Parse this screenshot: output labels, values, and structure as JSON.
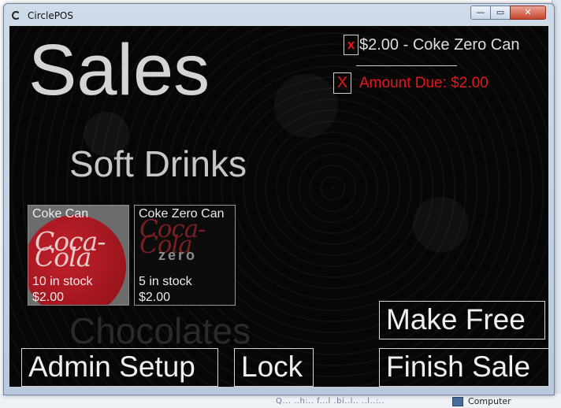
{
  "window": {
    "title": "CirclePOS",
    "controls": {
      "minimize": "—",
      "maximize": "▭",
      "close": "✕"
    }
  },
  "desktop": {
    "bottom_label": "Computer",
    "bottom_faded_text": "Q... ..h:.. f...l .bi..l.. ..l..:.."
  },
  "page": {
    "title": "Sales",
    "category": "Soft Drinks",
    "next_category": "Chocolates"
  },
  "order": {
    "remove_item_label": "x",
    "item_text": "$2.00 - Coke Zero Can",
    "remove_all_label": "X",
    "amount_due": "Amount Due: $2.00"
  },
  "products": [
    {
      "name": "Coke Can",
      "stock": "10 in stock",
      "price": "$2.00",
      "logo_text": "Coca-Cola"
    },
    {
      "name": "Coke Zero Can",
      "stock": "5 in stock",
      "price": "$2.00",
      "logo_text": "Coca-Cola",
      "logo_sub": "zero"
    }
  ],
  "actions": {
    "make_free": "Make Free",
    "admin_setup": "Admin Setup",
    "lock": "Lock",
    "finish_sale": "Finish Sale"
  },
  "colors": {
    "accent_red": "#e8161b",
    "text_light": "#d4d4d4",
    "background": "#060606"
  }
}
